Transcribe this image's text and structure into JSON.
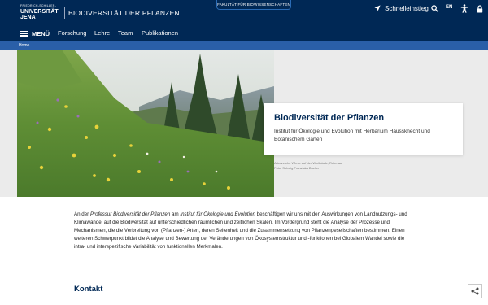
{
  "header": {
    "logo_line1": "FRIEDRICH-SCHILLER-",
    "logo_line2": "UNIVERSITÄT",
    "logo_line3": "JENA",
    "site_title": "BIODIVERSITÄT DER PFLANZEN",
    "faculty_tab": "FAKULTÄT FÜR BIOWISSENSCHAFTEN",
    "quick_entry": "Schnelleinstieg",
    "language": "EN"
  },
  "nav": {
    "menu_label": "MENÜ",
    "items": [
      "Forschung",
      "Lehre",
      "Team",
      "Publikationen"
    ]
  },
  "breadcrumb": {
    "home": "Home"
  },
  "hero": {
    "title": "Biodiversität der Pflanzen",
    "subtitle": "Institut für Ökologie und Evolution mit Herbarium Haussknecht und Botanischem Garten",
    "caption_line1": "Artenreiche Wiese auf der Wintlatalle, Rotenau",
    "caption_line2": "Foto: Solveig Franziska Bucher"
  },
  "intro": {
    "part1": "An der ",
    "em1": "Professur Biodiversität der Pflanzen",
    "part2": " am ",
    "em2": "Institut für Ökologie und Evolution",
    "part3": " beschäftigen wir uns mit den Auswirkungen von Landnutzungs- und Klimawandel auf die Biodiversität auf unterschiedlichen räumlichen und zeitlichen Skalen. Im Vordergrund steht die Analyse der Prozesse und Mechanismen, die die Verbreitung von (Pflanzen-) Arten, deren Seltenheit und die Zusammensetzung von Pflanzengesellschaften bestimmen. Einen weiteren Schwerpunkt bildet die Analyse und Bewertung der Veränderungen von Ökosystemstruktur und -funktionen bei Globalem Wandel sowie die intra- und interspezifische Variabilität von funktionellen Merkmalen."
  },
  "contact": {
    "heading": "Kontakt"
  },
  "colors": {
    "primary": "#002855",
    "accent": "#2a5fa8",
    "hero_background": "#ebebeb"
  },
  "icons": {
    "quick_entry": "location-arrow-icon",
    "search": "search-icon",
    "accessibility": "accessibility-icon",
    "lock": "lock-icon",
    "menu": "hamburger-icon",
    "share": "share-icon"
  }
}
